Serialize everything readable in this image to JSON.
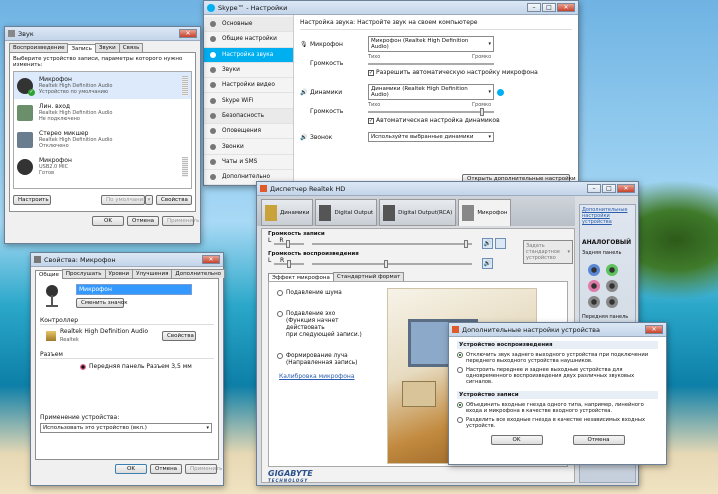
{
  "sound": {
    "title": "Звук",
    "tabs": [
      "Воспроизведение",
      "Запись",
      "Звуки",
      "Связь"
    ],
    "active_tab": 1,
    "instruction": "Выберите устройство записи, параметры которого нужно изменить:",
    "devices": [
      {
        "name": "Микрофон",
        "driver": "Realtek High Definition Audio",
        "status": "Устройство по умолчанию"
      },
      {
        "name": "Лин. вход",
        "driver": "Realtek High Definition Audio",
        "status": "Не подключено"
      },
      {
        "name": "Стерео микшер",
        "driver": "Realtek High Definition Audio",
        "status": "Отключено"
      },
      {
        "name": "Микрофон",
        "driver": "USB2.0 MIC",
        "status": "Готов"
      }
    ],
    "configure": "Настроить",
    "default": "По умолчанию",
    "properties": "Свойства",
    "ok": "OK",
    "cancel": "Отмена",
    "apply": "Применить"
  },
  "skype": {
    "title": "Skype™ - Настройки",
    "nav": [
      "Основные",
      "Общие настройки",
      "Настройка звука",
      "Звуки",
      "Настройки видео",
      "Skype WiFi",
      "Безопасность",
      "Оповещения",
      "Звонки",
      "Чаты и SMS",
      "Дополнительно"
    ],
    "nav_active": 2,
    "header": "Настройка звука: Настройте звук на своем компьютере",
    "mic_label": "Микрофон",
    "mic_device": "Микрофон (Realtek High Definition Audio)",
    "volume": "Громкость",
    "quiet": "Тихо",
    "loud": "Громко",
    "mic_auto": "Разрешить автоматическую настройку микрофона",
    "spk_label": "Динамики",
    "spk_device": "Динамики (Realtek High Definition Audio)",
    "spk_auto": "Автоматическая настройка динамиков",
    "ring_label": "Звонок",
    "ring_device": "Используйте выбранные динамики",
    "more_settings": "Открыть дополнительные настройки"
  },
  "realtek": {
    "title": "Диспетчер Realtek HD",
    "tabs": [
      "Динамики",
      "Digital Output",
      "Digital Output(RCA)",
      "Микрофон"
    ],
    "rec_volume": "Громкость записи",
    "play_volume": "Громкость воспроизведения",
    "L": "L",
    "R": "R",
    "default_device": "Задать стандартное устройство",
    "subtabs": [
      "Эффект микрофона",
      "Стандартный формат"
    ],
    "effects": [
      "Подавление шума",
      "Подавление эхо\n(Функция начнет действовать\nпри следующей записи.)",
      "Формирование луча\n(Направленная запись)"
    ],
    "calibration": "Калибровка микрофона",
    "side_link": "Дополнительные настройки устройства",
    "analog": "АНАЛОГОВЫЙ",
    "rear_panel": "Задняя панель",
    "front_panel": "Передняя панель",
    "logo": "GIGABYTE",
    "logo_sub": "TECHNOLOGY"
  },
  "mic_props": {
    "title": "Свойства: Микрофон",
    "tabs": [
      "Общие",
      "Прослушать",
      "Уровни",
      "Улучшения",
      "Дополнительно"
    ],
    "name_value": "Микрофон",
    "change_icon": "Сменить значок",
    "controller_label": "Контроллер",
    "controller_name": "Realtek High Definition Audio",
    "controller_vendor": "Realtek",
    "properties": "Свойства",
    "jack_label": "Разъем",
    "jack_value": "Передняя панель Разъем 3,5 мм",
    "usage_label": "Применение устройства:",
    "usage_value": "Использовать это устройство (вкл.)",
    "ok": "OK",
    "cancel": "Отмена",
    "apply": "Применить"
  },
  "adv": {
    "title": "Дополнительные настройки устройства",
    "playback_title": "Устройство воспроизведения",
    "playback_opts": [
      "Отключить звук заднего выходного устройства при подключении переднего выходного устройства наушников.",
      "Настроить переднее и заднее выходные устройства для одновременного воспроизведения двух различных звуковых сигналов."
    ],
    "record_title": "Устройство записи",
    "record_opts": [
      "Объединить входные гнезда одного типа, например, линейного входа и микрофона в качестве входного устройства.",
      "Разделить все входные гнезда в качестве независимых входных устройств."
    ],
    "ok": "OK",
    "cancel": "Отмена"
  }
}
